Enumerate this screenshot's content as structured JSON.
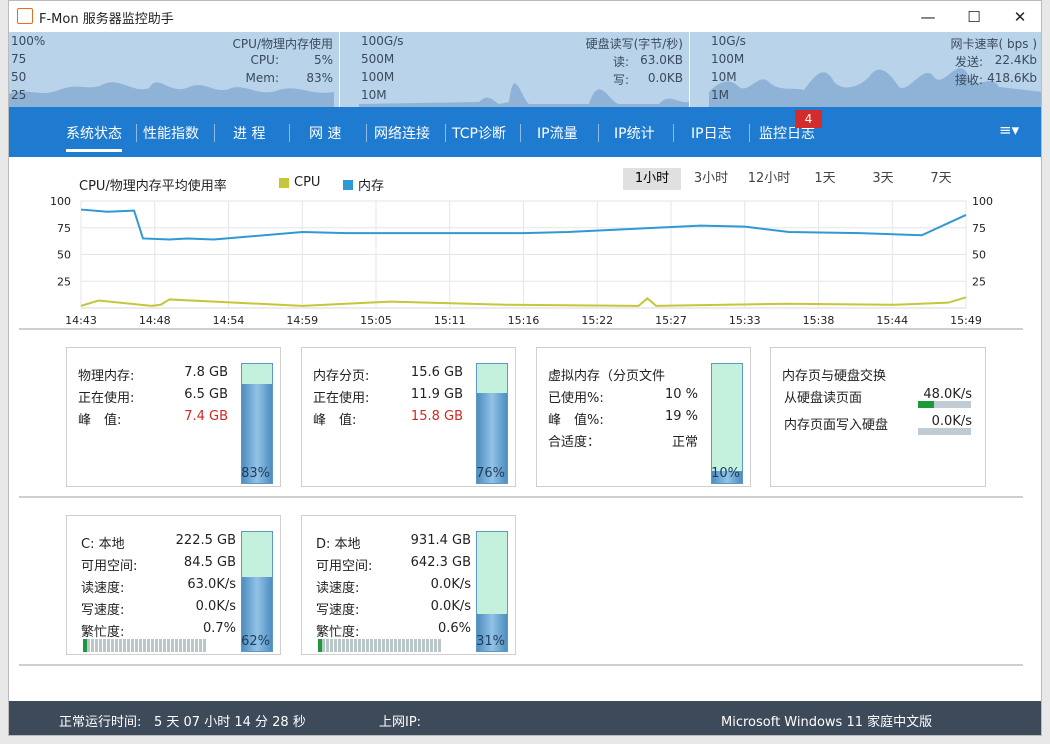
{
  "app": {
    "title": "F-Mon 服务器监控助手"
  },
  "window_buttons": {
    "minimize": "—",
    "maximize": "☐",
    "close": "✕"
  },
  "top": {
    "cpu": {
      "ticks": [
        "100%",
        "75",
        "50",
        "25"
      ],
      "title": "CPU/物理内存使用",
      "cpu_label": "CPU:",
      "cpu_value": "5%",
      "mem_label": "Mem:",
      "mem_value": "83%"
    },
    "disk": {
      "ticks": [
        "100G/s",
        "500M",
        "100M",
        "10M"
      ],
      "title": "硬盘读写(字节/秒)",
      "read_label": "读:",
      "read_value": "63.0KB",
      "write_label": "写:",
      "write_value": "0.0KB"
    },
    "net": {
      "ticks": [
        "10G/s",
        "100M",
        "10M",
        "1M"
      ],
      "title": "网卡速率( bps )",
      "send_label": "发送:",
      "send_value": "22.4Kb",
      "recv_label": "接收:",
      "recv_value": "418.6Kb"
    }
  },
  "tabs": [
    "系统状态",
    "性能指数",
    "进 程",
    "网 速",
    "网络连接",
    "TCP诊断",
    "IP流量",
    "IP统计",
    "IP日志",
    "监控日志"
  ],
  "active_tab": 0,
  "badge": "4",
  "menu_icon": "≡▾",
  "chart": {
    "title": "CPU/物理内存平均使用率",
    "legend": [
      {
        "label": "CPU",
        "color": "#c6c63a"
      },
      {
        "label": "内存",
        "color": "#2f99d4"
      }
    ],
    "ranges": [
      "1小时",
      "3小时",
      "12小时",
      "1天",
      "3天",
      "7天"
    ],
    "selected_range": 0
  },
  "chart_data": {
    "type": "line",
    "title": "CPU/物理内存平均使用率",
    "x": [
      "14:43",
      "14:48",
      "14:54",
      "14:59",
      "15:05",
      "15:11",
      "15:16",
      "15:22",
      "15:27",
      "15:33",
      "15:38",
      "15:44",
      "15:49"
    ],
    "ylim": [
      0,
      100
    ],
    "yticks": [
      100,
      75,
      50,
      25
    ],
    "series": [
      {
        "name": "内存",
        "color": "#2f99d4",
        "x": [
          0,
          3,
          6,
          7,
          10,
          12,
          15,
          25,
          30,
          40,
          50,
          55,
          60,
          70,
          75,
          80,
          88,
          95,
          100
        ],
        "values": [
          92,
          90,
          91,
          65,
          64,
          65,
          64,
          71,
          70,
          70,
          70,
          71,
          73,
          77,
          76,
          71,
          70,
          68,
          87
        ]
      },
      {
        "name": "CPU",
        "color": "#c6c63a",
        "x": [
          0,
          2,
          8,
          9,
          10,
          25,
          35,
          48,
          63,
          64,
          65,
          80,
          92,
          98,
          100
        ],
        "values": [
          2,
          7,
          2,
          3,
          8,
          2,
          6,
          3,
          2,
          9,
          2,
          4,
          3,
          5,
          10
        ]
      }
    ]
  },
  "mem": {
    "title1": "物理内存:",
    "value1": "7.8 GB",
    "title2": "正在使用:",
    "value2": "6.5 GB",
    "title3": "峰　值:",
    "value3": "7.4 GB",
    "percent": "83%",
    "level": 0.83
  },
  "page": {
    "title1": "内存分页:",
    "value1": "15.6 GB",
    "title2": "正在使用:",
    "value2": "11.9 GB",
    "title3": "峰　值:",
    "value3": "15.8 GB",
    "percent": "76%",
    "level": 0.76
  },
  "virt": {
    "title1": "虚拟内存（分页文件",
    "title2": "已使用%:",
    "value2": "10 %",
    "title3": "峰　值%:",
    "value3": "19 %",
    "title4": "合适度：",
    "value4": "正常",
    "percent": "10%",
    "level": 0.1
  },
  "swap": {
    "title": "内存页与硬盘交换",
    "row1": "从硬盘读页面",
    "value1": "48.0K/s",
    "level1": 0.3,
    "row2": "内存页面写入硬盘",
    "value2": "0.0K/s",
    "level2": 0.0
  },
  "diskC": {
    "name": "C: 本地",
    "total": "222.5 GB",
    "free_label": "可用空间:",
    "free": "84.5 GB",
    "read_label": "读速度:",
    "read": "63.0K/s",
    "write_label": "写速度:",
    "write": "0.0K/s",
    "busy_label": "繁忙度:",
    "busy": "0.7%",
    "percent": "62%",
    "level": 0.62
  },
  "diskD": {
    "name": "D: 本地",
    "total": "931.4 GB",
    "free_label": "可用空间:",
    "free": "642.3 GB",
    "read_label": "读速度:",
    "read": "0.0K/s",
    "write_label": "写速度:",
    "write": "0.0K/s",
    "busy_label": "繁忙度:",
    "busy": "0.6%",
    "percent": "31%",
    "level": 0.31
  },
  "status": {
    "uptime_label": "正常运行时间:",
    "uptime": "5  天  07 小时 14 分 28 秒",
    "ip_label": "上网IP:",
    "os": "Microsoft Windows 11 家庭中文版"
  }
}
